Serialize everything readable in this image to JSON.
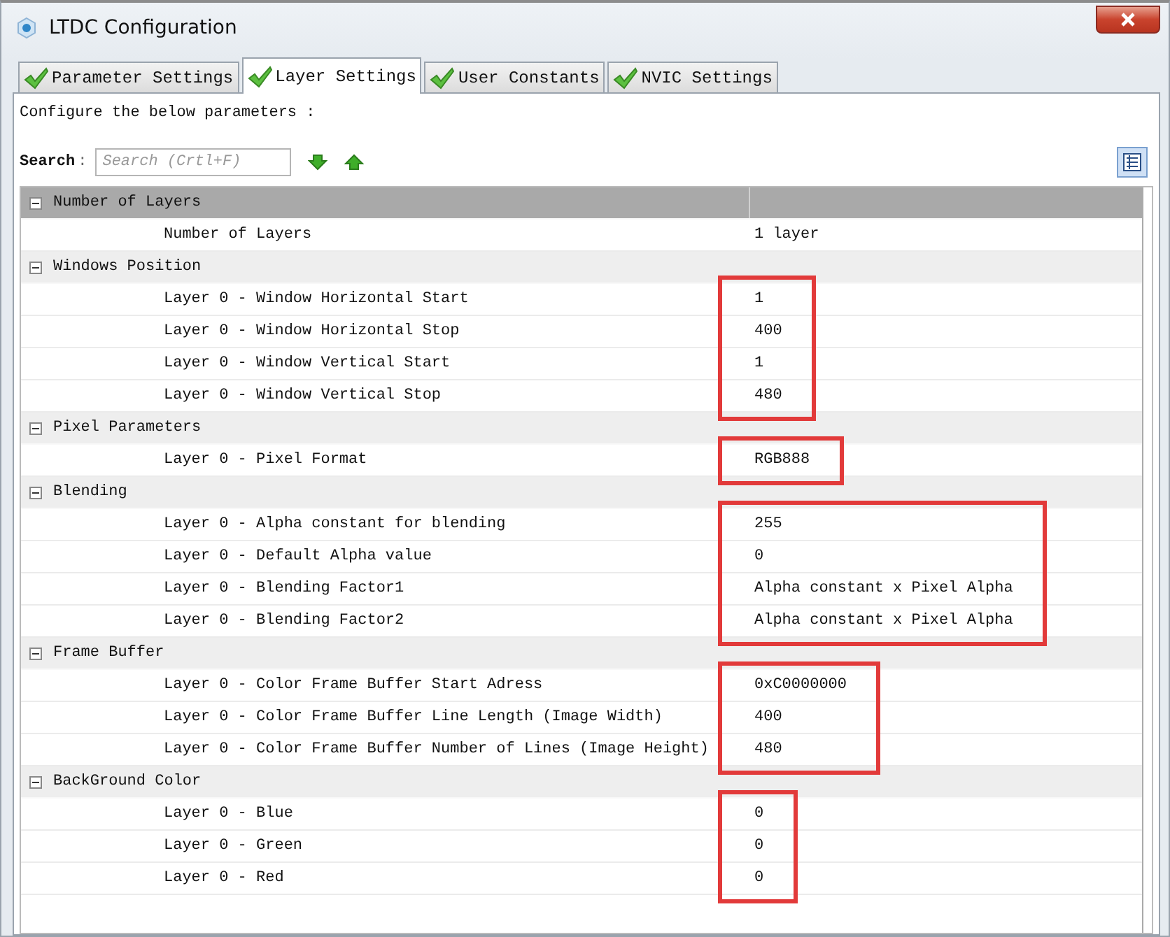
{
  "window": {
    "title": "LTDC Configuration"
  },
  "tabs": [
    {
      "label": "Parameter Settings",
      "selected": false,
      "valid": true
    },
    {
      "label": "Layer Settings",
      "selected": true,
      "valid": true
    },
    {
      "label": "User Constants",
      "selected": false,
      "valid": true
    },
    {
      "label": "NVIC Settings",
      "selected": false,
      "valid": true
    }
  ],
  "instruction": "Configure the below parameters :",
  "search": {
    "label": "Search",
    "separator": ":",
    "placeholder": "Search (Crtl+F)"
  },
  "sections": [
    {
      "title": "Number of Layers",
      "expanded": true,
      "selected": true,
      "rows": [
        {
          "name": "Number of Layers",
          "value": "1 layer"
        }
      ]
    },
    {
      "title": "Windows Position",
      "expanded": true,
      "selected": false,
      "outlined": true,
      "rows": [
        {
          "name": "Layer 0 - Window Horizontal Start",
          "value": "1"
        },
        {
          "name": "Layer 0 - Window Horizontal Stop",
          "value": "400"
        },
        {
          "name": "Layer 0 - Window Vertical Start",
          "value": "1"
        },
        {
          "name": "Layer 0 - Window Vertical Stop",
          "value": "480"
        }
      ]
    },
    {
      "title": "Pixel Parameters",
      "expanded": true,
      "selected": false,
      "outlined": true,
      "rows": [
        {
          "name": "Layer 0 - Pixel Format",
          "value": "RGB888"
        }
      ]
    },
    {
      "title": "Blending",
      "expanded": true,
      "selected": false,
      "outlined": true,
      "rows": [
        {
          "name": "Layer 0 - Alpha constant for blending",
          "value": "255"
        },
        {
          "name": "Layer 0 - Default Alpha value",
          "value": "0"
        },
        {
          "name": "Layer 0 - Blending Factor1",
          "value": "Alpha constant x Pixel Alpha"
        },
        {
          "name": "Layer 0 - Blending Factor2",
          "value": "Alpha constant x Pixel Alpha"
        }
      ]
    },
    {
      "title": "Frame Buffer",
      "expanded": true,
      "selected": false,
      "outlined": true,
      "rows": [
        {
          "name": "Layer 0 - Color Frame Buffer Start Adress",
          "value": "0xC0000000"
        },
        {
          "name": "Layer 0 - Color Frame Buffer Line Length (Image Width)",
          "value": "400"
        },
        {
          "name": "Layer 0 - Color Frame Buffer Number of Lines (Image Height)",
          "value": "480"
        }
      ]
    },
    {
      "title": "BackGround Color",
      "expanded": true,
      "selected": false,
      "outlined": true,
      "rows": [
        {
          "name": "Layer 0 - Blue",
          "value": "0"
        },
        {
          "name": "Layer 0 - Green",
          "value": "0"
        },
        {
          "name": "Layer 0 - Red",
          "value": "0"
        }
      ]
    }
  ]
}
